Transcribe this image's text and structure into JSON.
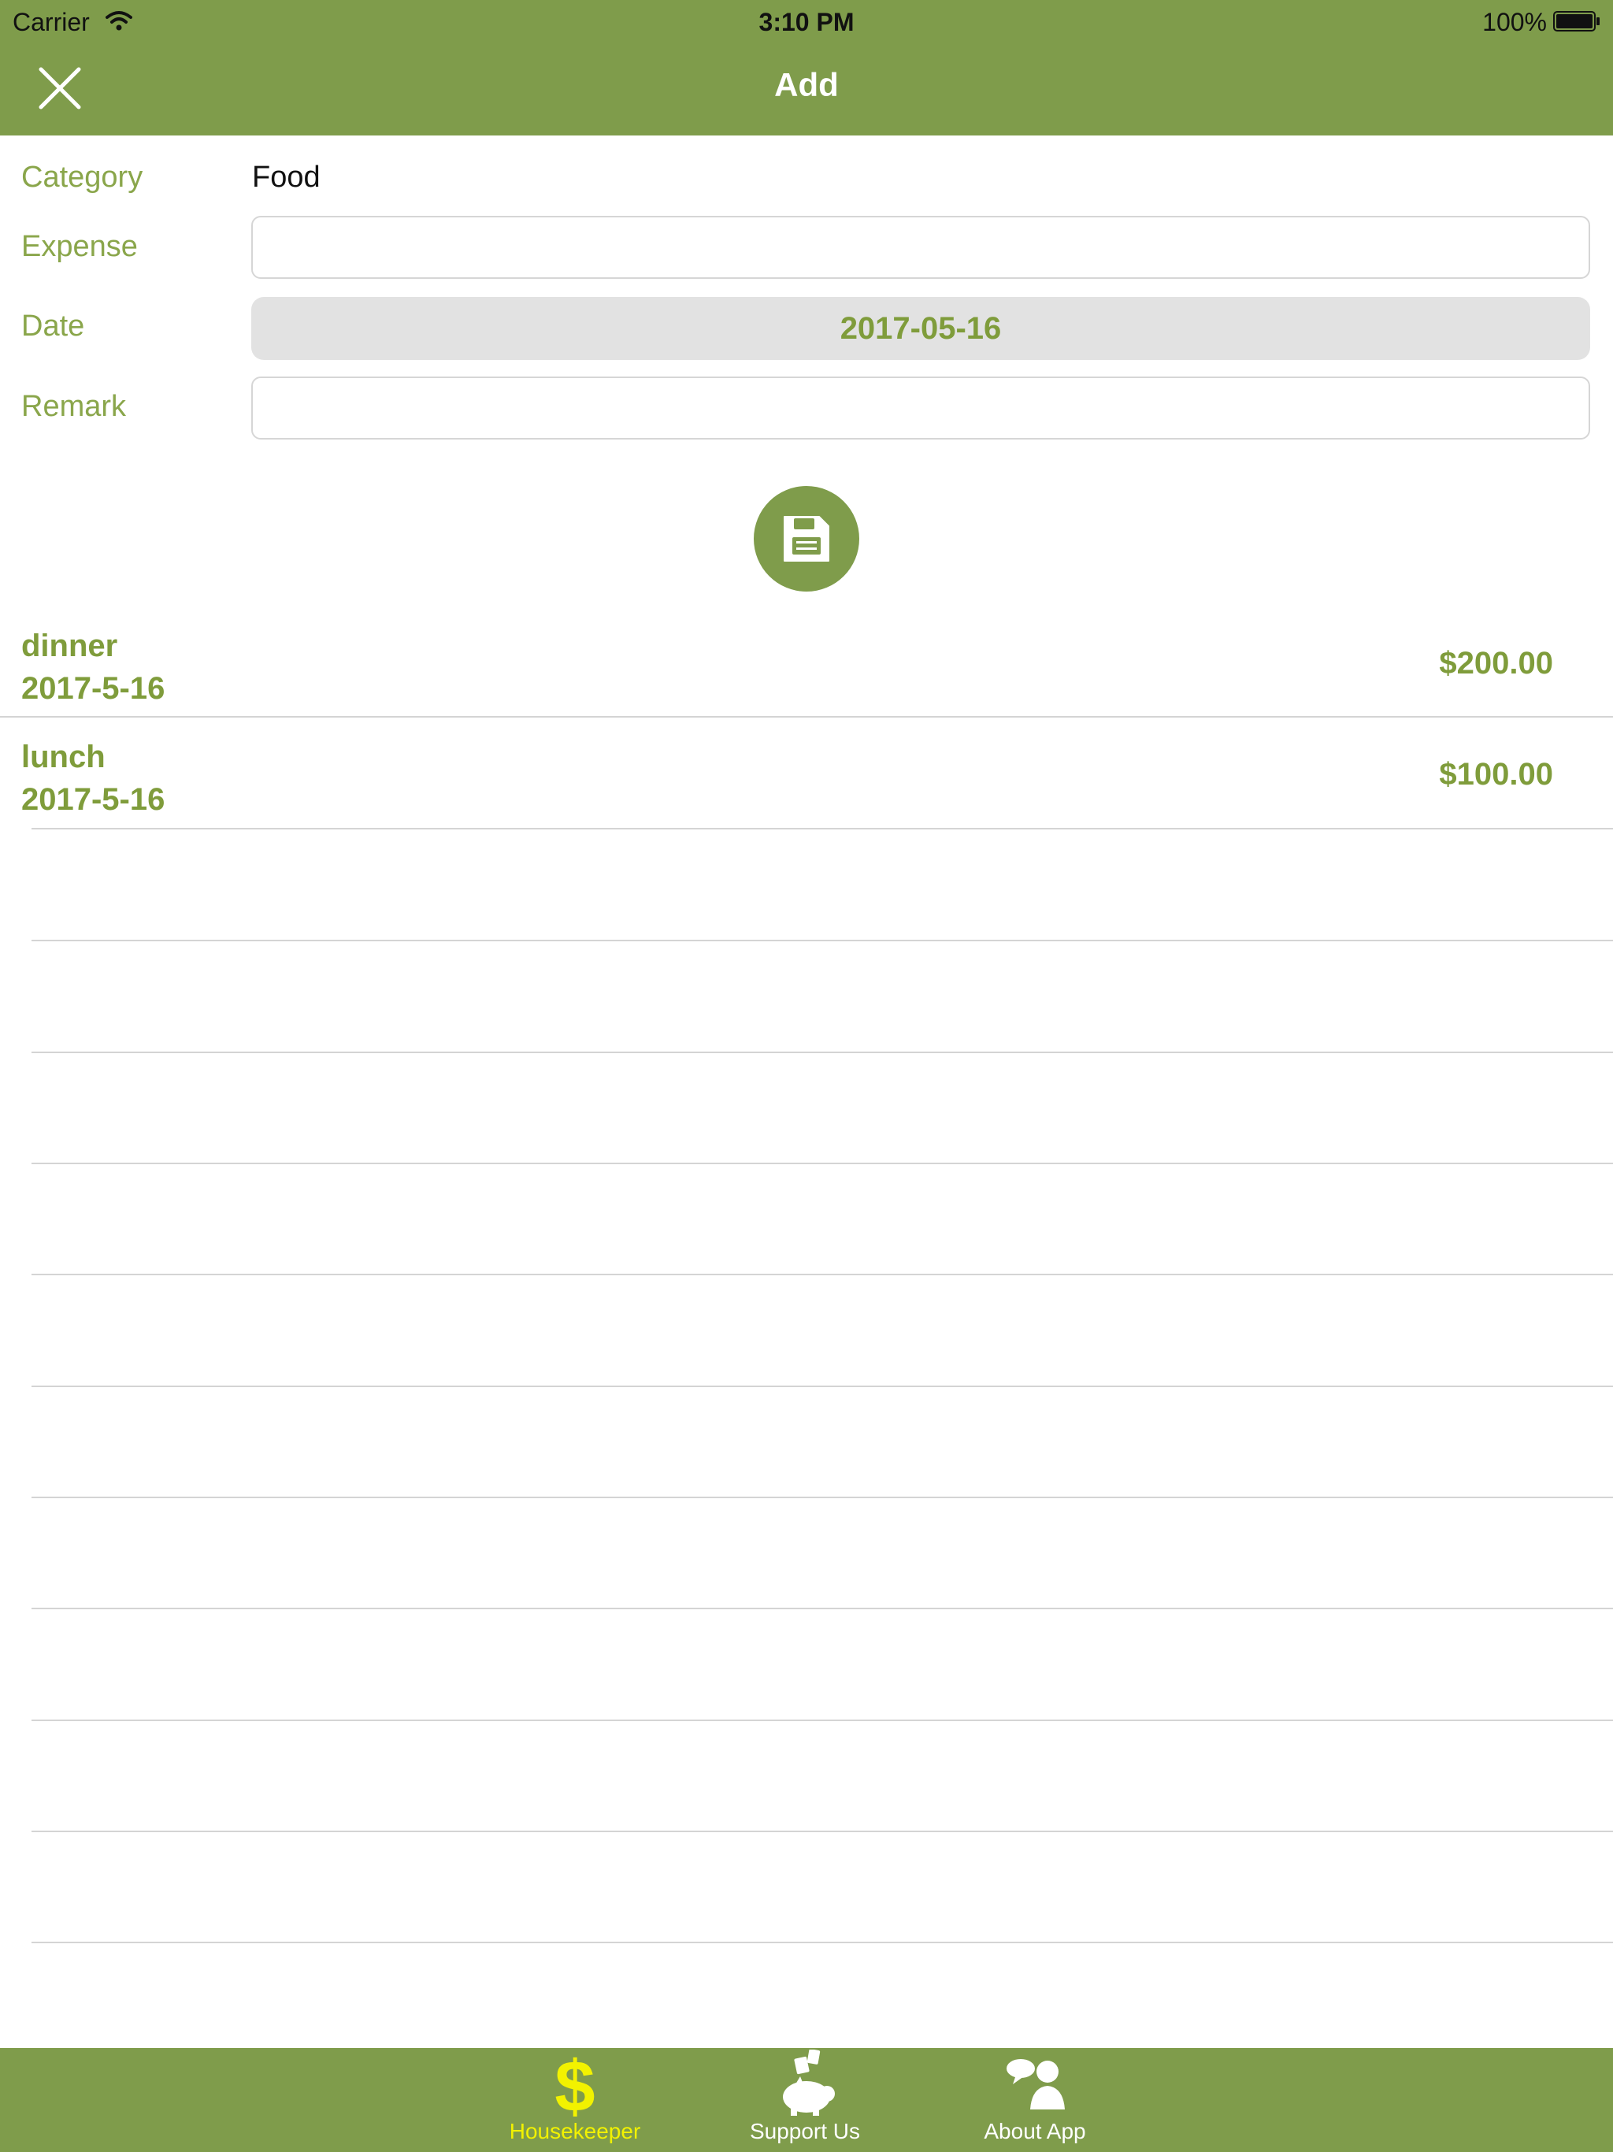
{
  "status_bar": {
    "carrier": "Carrier",
    "time": "3:10 PM",
    "battery": "100%"
  },
  "nav": {
    "title": "Add"
  },
  "form": {
    "category_label": "Category",
    "category_value": "Food",
    "expense_label": "Expense",
    "expense_value": "",
    "date_label": "Date",
    "date_value": "2017-05-16",
    "remark_label": "Remark",
    "remark_value": ""
  },
  "entries": [
    {
      "name": "dinner",
      "date": "2017-5-16",
      "amount": "$200.00"
    },
    {
      "name": "lunch",
      "date": "2017-5-16",
      "amount": "$100.00"
    }
  ],
  "tabs": [
    {
      "label": "Housekeeper",
      "icon": "dollar-icon",
      "active": true
    },
    {
      "label": "Support Us",
      "icon": "piggy-bank-icon",
      "active": false
    },
    {
      "label": "About App",
      "icon": "chat-people-icon",
      "active": false
    }
  ],
  "colors": {
    "brand": "#7f9c4b",
    "accent_text": "#8aa64b",
    "active_tab": "#f2f200"
  }
}
